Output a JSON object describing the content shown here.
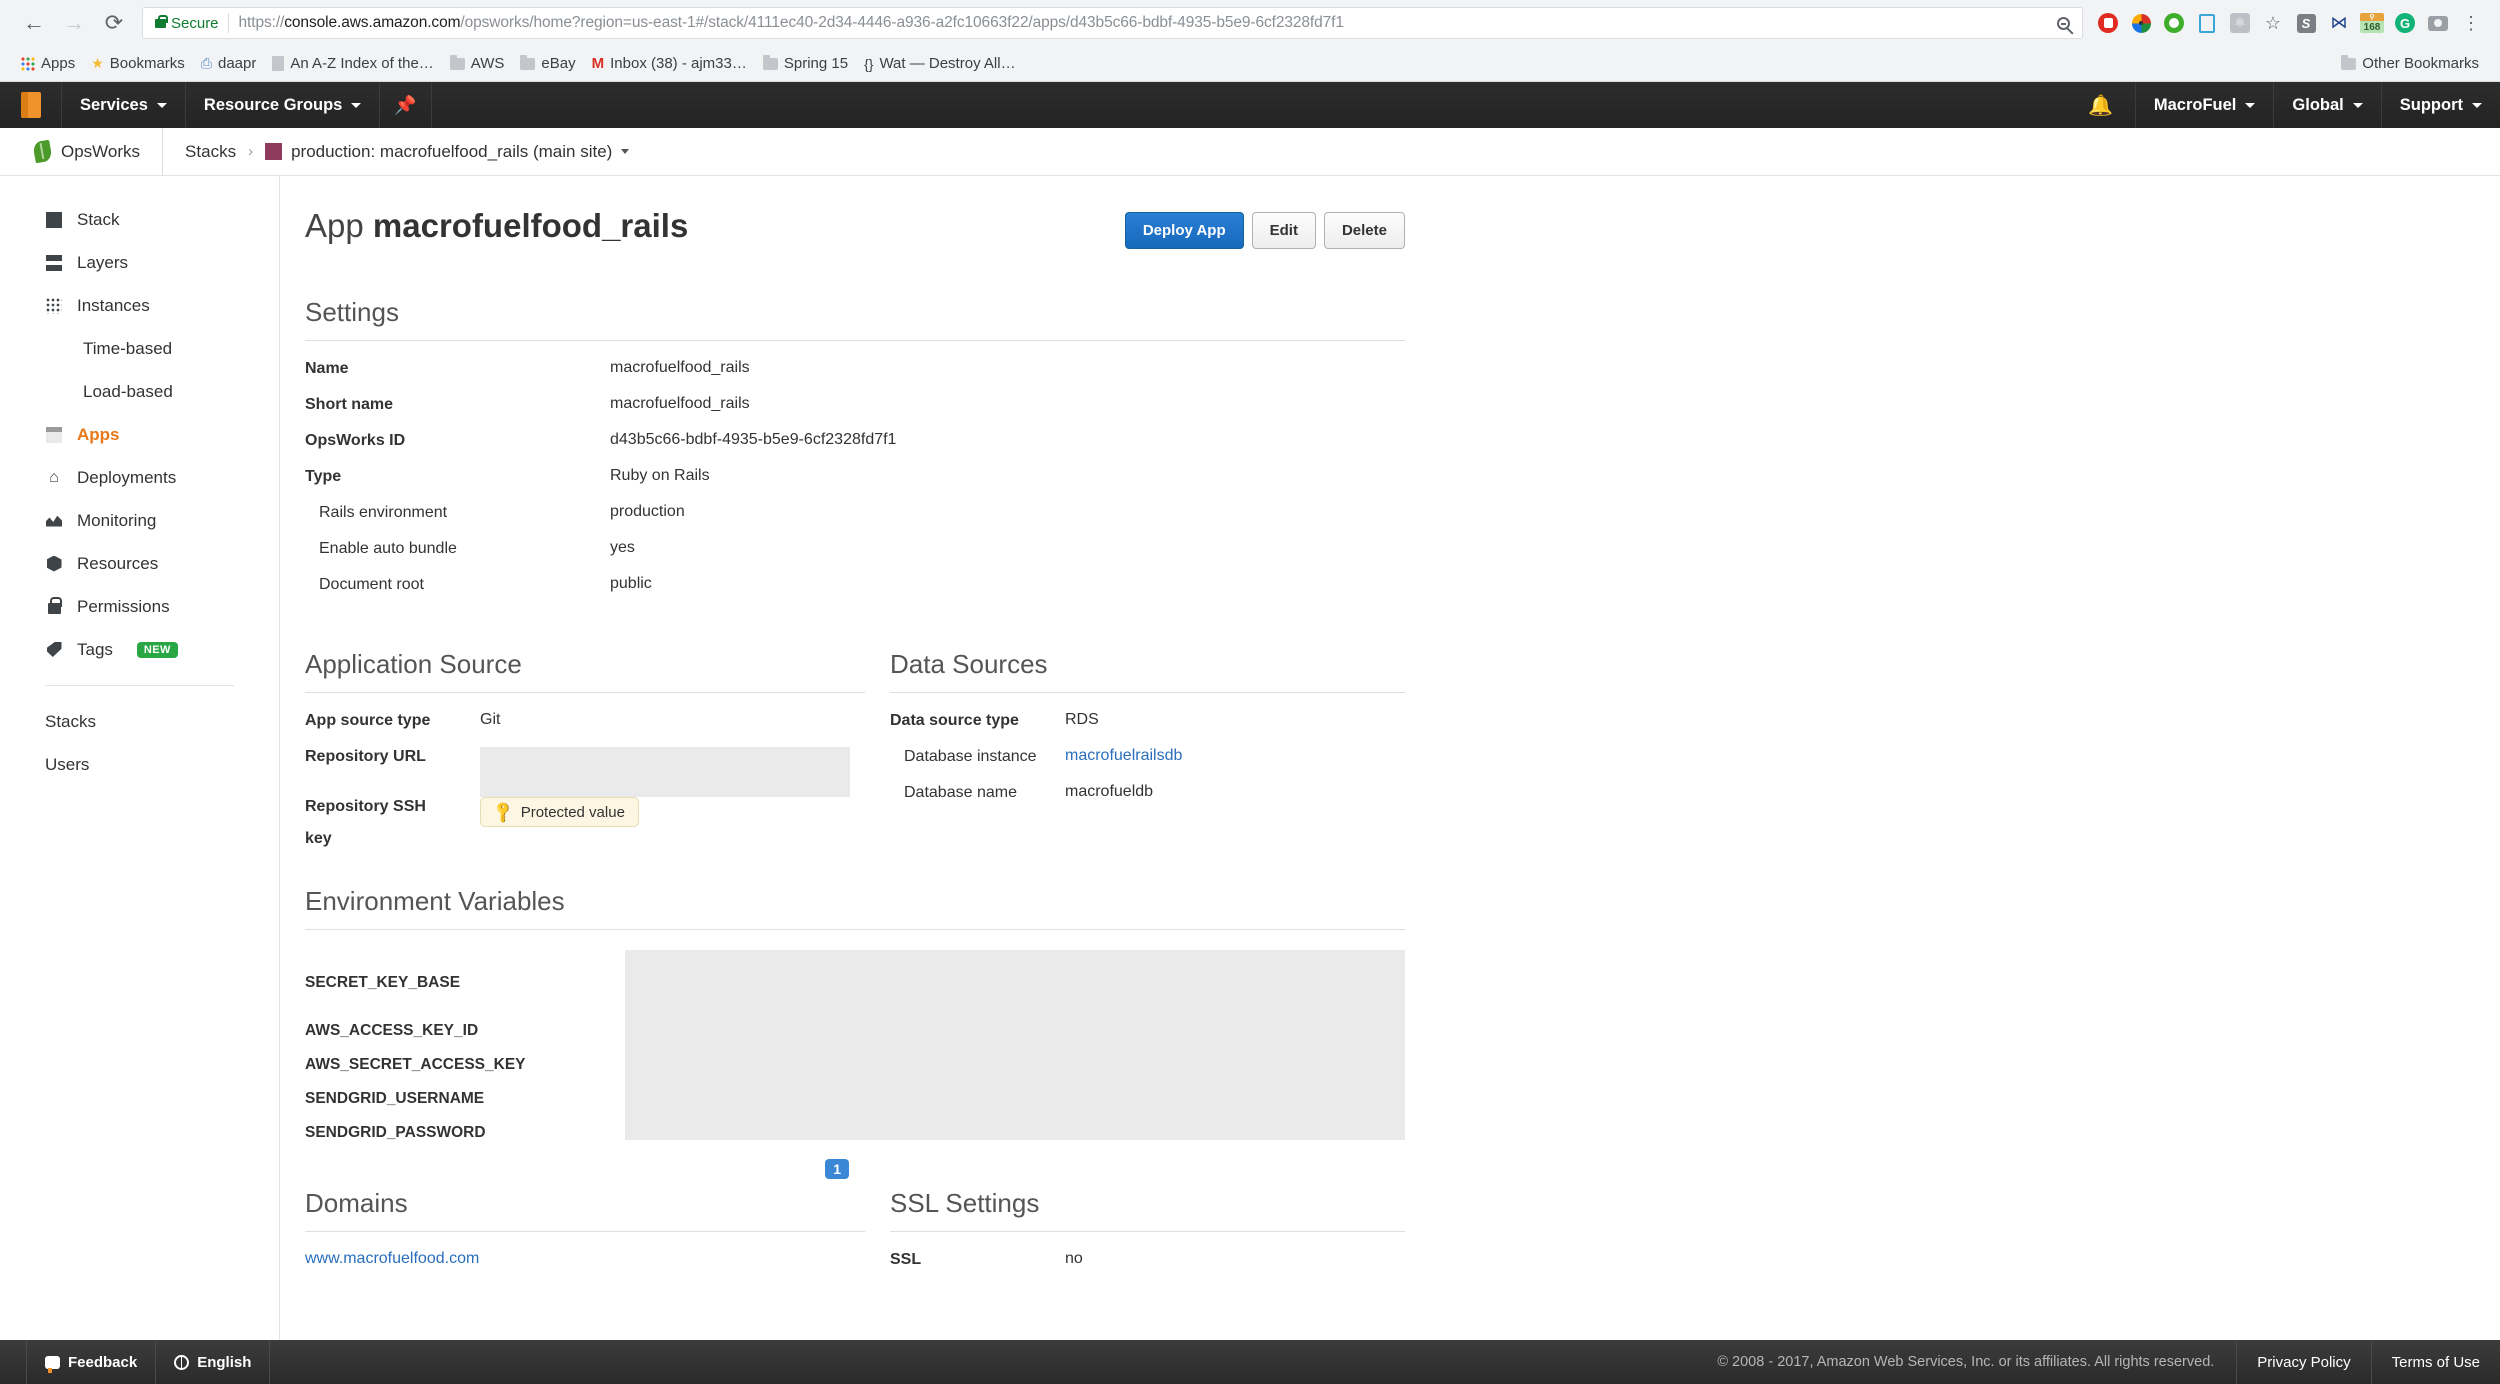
{
  "browser": {
    "back_icon": "back-arrow-icon",
    "forward_icon": "forward-arrow-icon",
    "reload_icon": "reload-icon",
    "secure_label": "Secure",
    "url_scheme": "https://",
    "url_host": "console.aws.amazon.com",
    "url_path": "/opsworks/home?region=us-east-1#/stack/4111ec40-2d34-4446-a936-a2fc10663f22/apps/d43b5c66-bdbf-4935-b5e9-6cf2328fd7f1",
    "url_full": "https://console.aws.amazon.com/opsworks/home?region=us-east-1#/stack/4111ec40-2d34-4446-a936-a2fc10663f22/apps/d43b5c66-bdbf-4935-b5e9-6cf2328fd7f1",
    "extensions": [
      {
        "name": "adblock-icon"
      },
      {
        "name": "color-wheel-icon"
      },
      {
        "name": "quantcast-icon"
      },
      {
        "name": "pocket-icon"
      },
      {
        "name": "react-devtools-icon"
      },
      {
        "name": "bookmark-star-icon"
      },
      {
        "name": "stylish-icon"
      },
      {
        "name": "bowtie-icon"
      },
      {
        "name": "counter-168-icon",
        "value": "168"
      },
      {
        "name": "grammarly-icon"
      },
      {
        "name": "screenshot-camera-icon"
      },
      {
        "name": "chrome-menu-icon"
      }
    ],
    "bookmarks": [
      {
        "label": "Apps",
        "icon": "apps-grid-icon"
      },
      {
        "label": "Bookmarks",
        "icon": "star-icon"
      },
      {
        "label": "daapr",
        "icon": "bookmark-icon"
      },
      {
        "label": "An A-Z Index of the…",
        "icon": "page-icon"
      },
      {
        "label": "AWS",
        "icon": "folder-icon"
      },
      {
        "label": "eBay",
        "icon": "folder-icon"
      },
      {
        "label": "Inbox (38) - ajm33…",
        "icon": "gmail-icon"
      },
      {
        "label": "Spring 15",
        "icon": "folder-icon"
      },
      {
        "label": "Wat — Destroy All…",
        "icon": "braces-icon"
      }
    ],
    "other_bookmarks": {
      "label": "Other Bookmarks",
      "icon": "folder-icon"
    }
  },
  "aws_nav": {
    "logo": "aws-cube-logo",
    "services": "Services",
    "resource_groups": "Resource Groups",
    "pin_icon": "pin-icon",
    "bell_icon": "notification-bell-icon",
    "account": "MacroFuel",
    "region": "Global",
    "support": "Support"
  },
  "breadcrumb": {
    "brand": "OpsWorks",
    "brand_icon": "opsworks-leaf-icon",
    "items": [
      "Stacks"
    ],
    "separator": "›",
    "current": "production: macrofuelfood_rails (main site)"
  },
  "sidebar": {
    "items": [
      {
        "label": "Stack",
        "icon": "stack-icon",
        "sub": false,
        "active": false
      },
      {
        "label": "Layers",
        "icon": "layers-icon",
        "sub": false,
        "active": false
      },
      {
        "label": "Instances",
        "icon": "instances-grid-icon",
        "sub": false,
        "active": false
      },
      {
        "label": "Time-based",
        "icon": "",
        "sub": true,
        "active": false
      },
      {
        "label": "Load-based",
        "icon": "",
        "sub": true,
        "active": false
      },
      {
        "label": "Apps",
        "icon": "apps-icon",
        "sub": false,
        "active": true
      },
      {
        "label": "Deployments",
        "icon": "deployments-icon",
        "sub": false,
        "active": false
      },
      {
        "label": "Monitoring",
        "icon": "monitoring-chart-icon",
        "sub": false,
        "active": false
      },
      {
        "label": "Resources",
        "icon": "resources-cube-icon",
        "sub": false,
        "active": false
      },
      {
        "label": "Permissions",
        "icon": "lock-icon",
        "sub": false,
        "active": false
      },
      {
        "label": "Tags",
        "icon": "tag-icon",
        "sub": false,
        "active": false,
        "badge": "NEW"
      }
    ],
    "footer_items": [
      {
        "label": "Stacks"
      },
      {
        "label": "Users"
      }
    ]
  },
  "page": {
    "title_prefix": "App",
    "title_name": "macrofuelfood_rails",
    "buttons": {
      "deploy": "Deploy App",
      "edit": "Edit",
      "delete": "Delete"
    }
  },
  "settings": {
    "heading": "Settings",
    "rows": [
      {
        "key": "Name",
        "value": "macrofuelfood_rails",
        "indent": false
      },
      {
        "key": "Short name",
        "value": "macrofuelfood_rails",
        "indent": false
      },
      {
        "key": "OpsWorks ID",
        "value": "d43b5c66-bdbf-4935-b5e9-6cf2328fd7f1",
        "indent": false
      },
      {
        "key": "Type",
        "value": "Ruby on Rails",
        "indent": false
      },
      {
        "key": "Rails environment",
        "value": "production",
        "indent": true
      },
      {
        "key": "Enable auto bundle",
        "value": "yes",
        "indent": true
      },
      {
        "key": "Document root",
        "value": "public",
        "indent": true
      }
    ]
  },
  "application_source": {
    "heading": "Application Source",
    "app_source_type_key": "App source type",
    "app_source_type_value": "Git",
    "repository_url_key": "Repository URL",
    "repository_url_value": "",
    "repository_ssh_key_key": "Repository SSH",
    "repository_ssh_key_key2": "key",
    "protected_chip_label": "Protected value"
  },
  "data_sources": {
    "heading": "Data Sources",
    "rows": [
      {
        "key": "Data source type",
        "value": "RDS",
        "indent": false,
        "link": false
      },
      {
        "key": "Database instance",
        "value": "macrofuelrailsdb",
        "indent": true,
        "link": true
      },
      {
        "key": "Database name",
        "value": "macrofueldb",
        "indent": true,
        "link": false
      }
    ]
  },
  "environment_variables": {
    "heading": "Environment Variables",
    "keys": [
      "SECRET_KEY_BASE",
      "AWS_ACCESS_KEY_ID",
      "AWS_SECRET_ACCESS_KEY",
      "SENDGRID_USERNAME",
      "SENDGRID_PASSWORD"
    ]
  },
  "domains": {
    "heading": "Domains",
    "count": "1",
    "items": [
      "www.macrofuelfood.com"
    ]
  },
  "ssl_settings": {
    "heading": "SSL Settings",
    "key": "SSL",
    "value": "no"
  },
  "footer": {
    "feedback": "Feedback",
    "language": "English",
    "copyright": "© 2008 - 2017, Amazon Web Services, Inc. or its affiliates. All rights reserved.",
    "privacy": "Privacy Policy",
    "terms": "Terms of Use"
  },
  "colors": {
    "accent_orange": "#e8781a",
    "primary_blue": "#1769bd",
    "link_blue": "#2a6ebb",
    "secure_green": "#0f7b30",
    "badge_green": "#29a745",
    "stack_chip": "#8e3b5e"
  }
}
